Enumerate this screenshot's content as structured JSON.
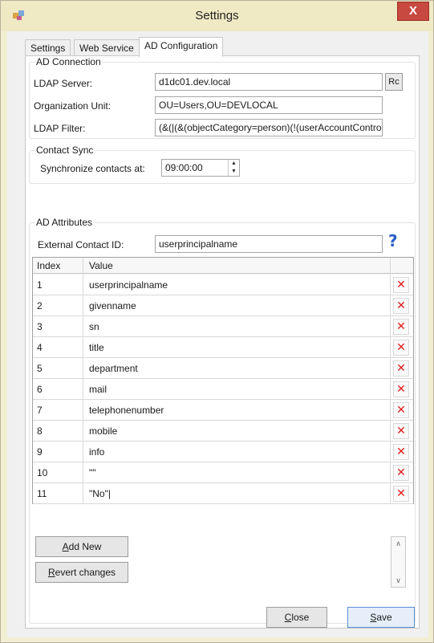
{
  "window": {
    "title": "Settings",
    "close_label": "X"
  },
  "tabs": [
    {
      "label": "Settings"
    },
    {
      "label": "Web Service"
    },
    {
      "label": "AD Configuration"
    }
  ],
  "ad_connection": {
    "group_title": "AD Connection",
    "ldap_server_label": "LDAP Server:",
    "ldap_server_value": "d1dc01.dev.local",
    "browse_label": "Rc",
    "ou_label": "Organization Unit:",
    "ou_value": "OU=Users,OU=DEVLOCAL",
    "filter_label": "LDAP Filter:",
    "filter_value": "(&(|(&(objectCategory=person)(!(userAccountContro"
  },
  "contact_sync": {
    "group_title": "Contact Sync",
    "sync_label": "Synchronize contacts at:",
    "sync_value": "09:00:00"
  },
  "ad_attributes": {
    "group_title": "AD Attributes",
    "external_id_label": "External Contact ID:",
    "external_id_value": "userprincipalname",
    "help_glyph": "?"
  },
  "grid": {
    "columns": {
      "index": "Index",
      "value": "Value"
    },
    "rows": [
      {
        "index": "1",
        "value": "userprincipalname"
      },
      {
        "index": "2",
        "value": "givenname"
      },
      {
        "index": "3",
        "value": "sn"
      },
      {
        "index": "4",
        "value": "title"
      },
      {
        "index": "5",
        "value": "department"
      },
      {
        "index": "6",
        "value": "mail"
      },
      {
        "index": "7",
        "value": "telephonenumber"
      },
      {
        "index": "8",
        "value": "mobile"
      },
      {
        "index": "9",
        "value": "info"
      },
      {
        "index": "10",
        "value": "\"\""
      },
      {
        "index": "11",
        "value": "\"No\"|"
      }
    ],
    "delete_glyph": "✕"
  },
  "buttons": {
    "add_new_accel": "A",
    "add_new_rest": "dd New",
    "revert_accel": "R",
    "revert_rest": "evert changes",
    "close_accel": "C",
    "close_rest": "lose",
    "save_accel": "S",
    "save_rest": "ave"
  },
  "colors": {
    "delete": "#e31c1c",
    "help": "#2a5fc6",
    "titlebar": "#efe9c4"
  }
}
